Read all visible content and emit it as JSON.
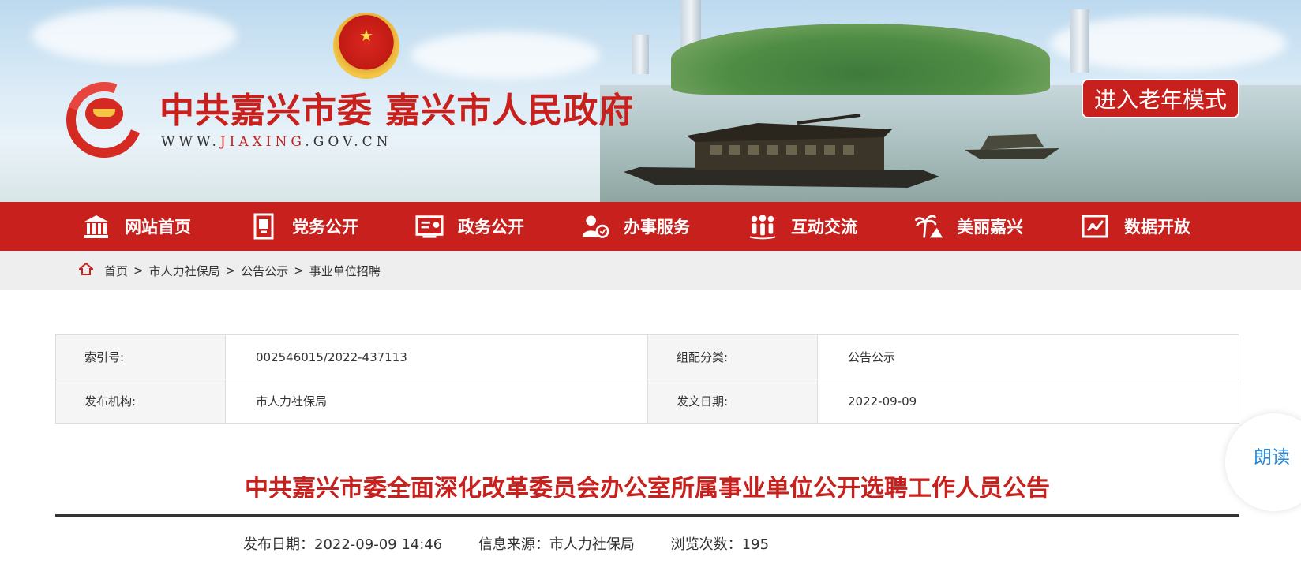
{
  "header": {
    "site_title": "中共嘉兴市委 嘉兴市人民政府",
    "site_url_prefix": "WWW.",
    "site_url_highlight": "JIAXING",
    "site_url_suffix": ".GOV.CN",
    "elder_mode_label": "进入老年模式"
  },
  "nav": {
    "items": [
      {
        "label": "网站首页",
        "icon": "home-temple-icon"
      },
      {
        "label": "党务公开",
        "icon": "party-flag-icon"
      },
      {
        "label": "政务公开",
        "icon": "document-board-icon"
      },
      {
        "label": "办事服务",
        "icon": "service-person-icon"
      },
      {
        "label": "互动交流",
        "icon": "people-group-icon"
      },
      {
        "label": "美丽嘉兴",
        "icon": "palm-tree-icon"
      },
      {
        "label": "数据开放",
        "icon": "data-chart-icon"
      }
    ]
  },
  "breadcrumb": {
    "items": [
      "首页",
      "市人力社保局",
      "公告公示",
      "事业单位招聘"
    ],
    "separator": ">"
  },
  "meta": {
    "index_label": "索引号:",
    "index_value": "002546015/2022-437113",
    "category_label": "组配分类:",
    "category_value": "公告公示",
    "publisher_label": "发布机构:",
    "publisher_value": "市人力社保局",
    "date_label": "发文日期:",
    "date_value": "2022-09-09"
  },
  "read_aloud_label": "朗读",
  "article": {
    "title": "中共嘉兴市委全面深化改革委员会办公室所属事业单位公开选聘工作人员公告",
    "publish_date": "发布日期：2022-09-09 14:46",
    "source": "信息来源：市人力社保局",
    "views": "浏览次数：195"
  },
  "colors": {
    "brand_red": "#c8201c",
    "breadcrumb_bg": "#eeeeee",
    "read_aloud_blue": "#2a8ad8"
  }
}
